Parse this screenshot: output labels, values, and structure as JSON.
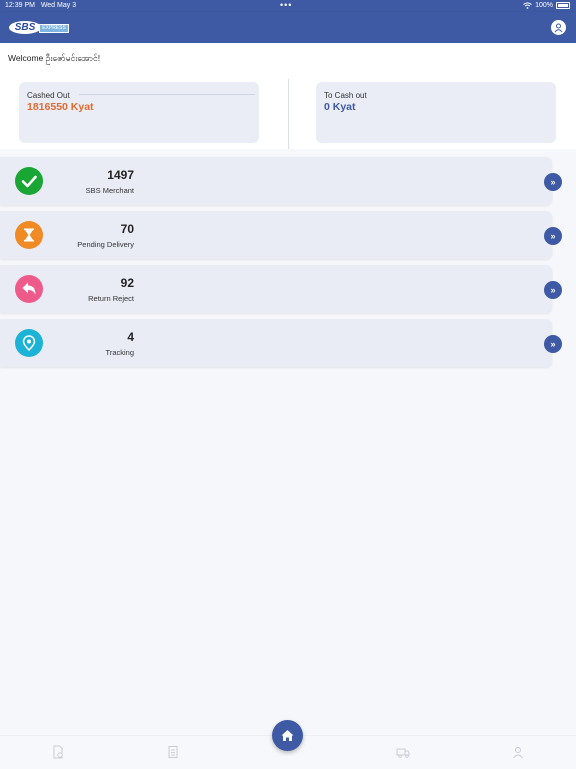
{
  "status_bar": {
    "time": "12:39 PM",
    "date": "Wed May 3",
    "dots": "•••",
    "battery": "100%"
  },
  "header": {
    "logo_text": "SBS",
    "logo_tag": "EXPRESS"
  },
  "welcome": "Welcome ဦးဇော်မင်းအောင်!",
  "summary": {
    "cashed_out_label": "Cashed Out",
    "cashed_out_value": "1816550 Kyat",
    "to_cash_out_label": "To Cash out",
    "to_cash_out_value": "0 Kyat"
  },
  "rows": [
    {
      "count": "1497",
      "label": "SBS Merchant",
      "icon": "check-icon",
      "color": "#1aa634"
    },
    {
      "count": "70",
      "label": "Pending Delivery",
      "icon": "hourglass-icon",
      "color": "#ef8a24"
    },
    {
      "count": "92",
      "label": "Return Reject",
      "icon": "return-arrow-icon",
      "color": "#ee5b8a"
    },
    {
      "count": "4",
      "label": "Tracking",
      "icon": "location-pin-icon",
      "color": "#1cb3d6"
    }
  ],
  "arrow_glyph": "»",
  "colors": {
    "primary": "#3f5aa4",
    "cashed_out": "#e26a2c"
  }
}
